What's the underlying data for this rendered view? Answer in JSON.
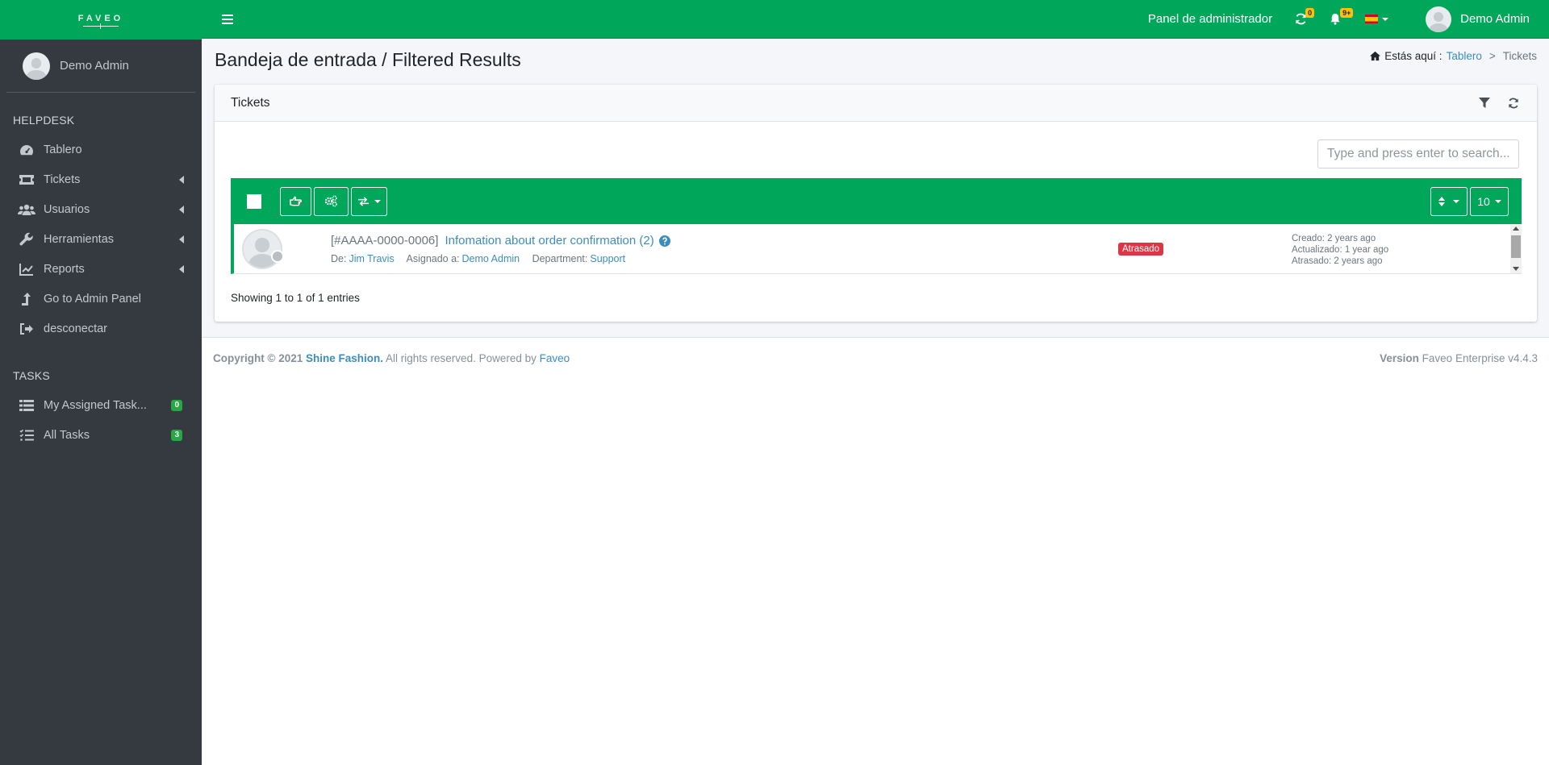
{
  "brand": {
    "logo_text": "FAVEO"
  },
  "sidebar": {
    "user_name": "Demo Admin",
    "helpdesk_header": "HELPDESK",
    "items": [
      {
        "label": "Tablero",
        "icon": "dashboard-icon"
      },
      {
        "label": "Tickets",
        "icon": "ticket-icon"
      },
      {
        "label": "Usuarios",
        "icon": "users-icon"
      },
      {
        "label": "Herramientas",
        "icon": "wrench-icon"
      },
      {
        "label": "Reports",
        "icon": "chart-icon"
      },
      {
        "label": "Go to Admin Panel",
        "icon": "arrow-up-icon"
      },
      {
        "label": "desconectar",
        "icon": "sign-out-icon"
      }
    ],
    "tasks_header": "TASKS",
    "tasks": [
      {
        "label": "My Assigned Task...",
        "count": "0",
        "icon": "list-icon"
      },
      {
        "label": "All Tasks",
        "count": "3",
        "icon": "tasks-icon"
      }
    ]
  },
  "topbar": {
    "admin_panel_link": "Panel de administrador",
    "refresh_badge": "0",
    "notifications_badge": "9+",
    "language": "es",
    "user_name": "Demo Admin"
  },
  "page": {
    "title": "Bandeja de entrada / Filtered Results",
    "breadcrumb_prefix": "Estás aquí :",
    "breadcrumb_link": "Tablero",
    "breadcrumb_separator": ">",
    "breadcrumb_current": "Tickets"
  },
  "tickets_card": {
    "title": "Tickets",
    "search_placeholder": "Type and press enter to search...",
    "per_page": "10",
    "entries_text": "Showing 1 to 1 of 1 entries",
    "rows": [
      {
        "ticket_id": "[#AAAA-0000-0006]",
        "subject": "Infomation about order confirmation (2)",
        "from_label": "De:",
        "from": "Jim Travis",
        "assigned_label": "Asignado a:",
        "assigned": "Demo Admin",
        "department_label": "Department:",
        "department": "Support",
        "status_badge": "Atrasado",
        "created": "Creado: 2 years ago",
        "updated": "Actualizado: 1 year ago",
        "overdue": "Atrasado: 2 years ago"
      }
    ]
  },
  "footer": {
    "copyright_prefix": "Copyright © 2021",
    "company": "Shine Fashion.",
    "rights": "All rights reserved. Powered by",
    "powered_by": "Faveo",
    "version_label": "Version",
    "version_value": "Faveo Enterprise v4.4.3"
  },
  "colors": {
    "brand_green": "#00a65a",
    "sidebar_bg": "#343a40",
    "link_blue": "#3c8dbc",
    "danger_red": "#dc3545",
    "badge_green": "#28a745",
    "badge_yellow": "#ffc107"
  }
}
